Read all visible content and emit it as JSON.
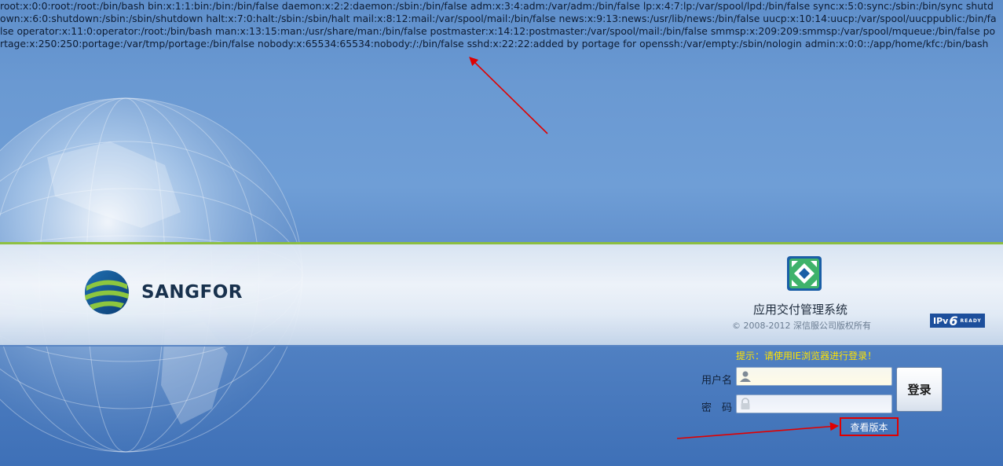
{
  "passwd_dump": "root:x:0:0:root:/root:/bin/bash bin:x:1:1:bin:/bin:/bin/false daemon:x:2:2:daemon:/sbin:/bin/false adm:x:3:4:adm:/var/adm:/bin/false lp:x:4:7:lp:/var/spool/lpd:/bin/false sync:x:5:0:sync:/sbin:/bin/sync shutdown:x:6:0:shutdown:/sbin:/sbin/shutdown halt:x:7:0:halt:/sbin:/sbin/halt mail:x:8:12:mail:/var/spool/mail:/bin/false news:x:9:13:news:/usr/lib/news:/bin/false uucp:x:10:14:uucp:/var/spool/uucppublic:/bin/false operator:x:11:0:operator:/root:/bin/bash man:x:13:15:man:/usr/share/man:/bin/false postmaster:x:14:12:postmaster:/var/spool/mail:/bin/false smmsp:x:209:209:smmsp:/var/spool/mqueue:/bin/false portage:x:250:250:portage:/var/tmp/portage:/bin/false nobody:x:65534:65534:nobody:/:/bin/false sshd:x:22:22:added by portage for openssh:/var/empty:/sbin/nologin admin:x:0:0::/app/home/kfc:/bin/bash",
  "brand": {
    "name": "SANGFOR"
  },
  "product": {
    "title": "应用交付管理系统",
    "copyright": "© 2008-2012   深信服公司版权所有",
    "ipv6_badge": {
      "prefix": "IPv",
      "number": "6",
      "suffix": "READY"
    }
  },
  "login": {
    "hint": "提示：请使用IE浏览器进行登录！",
    "username_label": "用户名",
    "password_label": "密　码",
    "username_value": "",
    "password_value": "",
    "submit_label": "登录",
    "version_link": "查看版本"
  },
  "colors": {
    "hint": "#ffe200",
    "highlight_box": "#e00000",
    "accent_stripe": "#8ec13a"
  }
}
